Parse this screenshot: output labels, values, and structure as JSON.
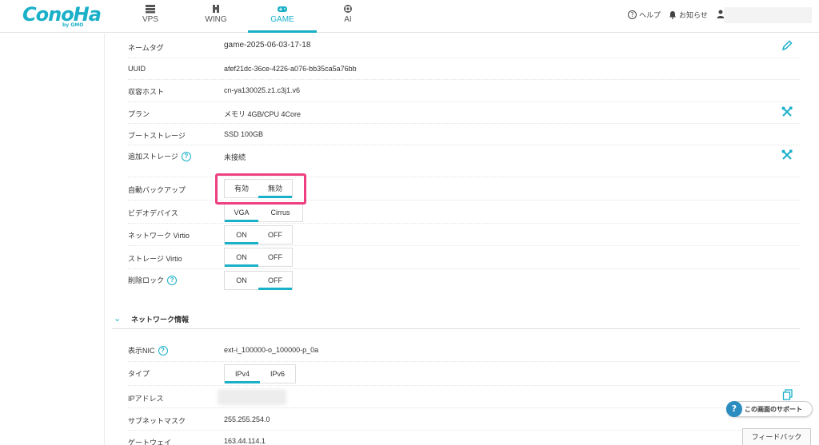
{
  "brand": {
    "logo": "ConoHa",
    "logo_sub": "by GMO"
  },
  "nav": {
    "tabs": [
      {
        "label": "VPS",
        "icon": "server-icon"
      },
      {
        "label": "WING",
        "icon": "wing-icon"
      },
      {
        "label": "GAME",
        "icon": "gamepad-icon",
        "active": true
      },
      {
        "label": "AI",
        "icon": "ai-chip-icon"
      }
    ],
    "help": "ヘルプ",
    "notice": "お知らせ"
  },
  "details": {
    "name_tag": {
      "label": "ネームタグ",
      "value": "game-2025-06-03-17-18"
    },
    "uuid": {
      "label": "UUID",
      "value": "afef21dc-36ce-4226-a076-bb35ca5a76bb"
    },
    "host": {
      "label": "収容ホスト",
      "value": "cn-ya130025.z1.c3j1.v6"
    },
    "plan": {
      "label": "プラン",
      "value": "メモリ 4GB/CPU 4Core"
    },
    "boot_storage": {
      "label": "ブートストレージ",
      "value": "SSD 100GB"
    },
    "extra_storage": {
      "label": "追加ストレージ",
      "value": "未接続"
    },
    "auto_backup": {
      "label": "自動バックアップ",
      "options": [
        "有効",
        "無効"
      ],
      "selected": "無効"
    },
    "video_device": {
      "label": "ビデオデバイス",
      "options": [
        "VGA",
        "Cirrus"
      ],
      "selected": "VGA"
    },
    "network_virtio": {
      "label": "ネットワーク Virtio",
      "options": [
        "ON",
        "OFF"
      ],
      "selected": "ON"
    },
    "storage_virtio": {
      "label": "ストレージ Virtio",
      "options": [
        "ON",
        "OFF"
      ],
      "selected": "ON"
    },
    "delete_lock": {
      "label": "削除ロック",
      "options": [
        "ON",
        "OFF"
      ],
      "selected": "OFF"
    }
  },
  "network": {
    "section_title": "ネットワーク情報",
    "nic": {
      "label": "表示NIC",
      "value": "ext-i_100000-o_100000-p_0a"
    },
    "type": {
      "label": "タイプ",
      "options": [
        "IPv4",
        "IPv6"
      ],
      "selected": "IPv4"
    },
    "ip": {
      "label": "IPアドレス",
      "value": ""
    },
    "subnet": {
      "label": "サブネットマスク",
      "value": "255.255.254.0"
    },
    "gateway": {
      "label": "ゲートウェイ",
      "value": "163.44.114.1"
    }
  },
  "support": {
    "label": "この画面のサポート",
    "icon": "question-icon"
  },
  "feedback": {
    "label": "フィードバック"
  },
  "colors": {
    "accent": "#19b0c8",
    "highlight": "#ee3f80"
  }
}
